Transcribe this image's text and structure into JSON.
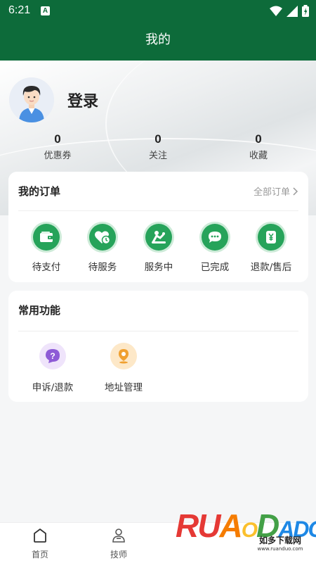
{
  "status_bar": {
    "time": "6:21",
    "notification_icon": "A"
  },
  "header": {
    "title": "我的"
  },
  "profile": {
    "login_text": "登录"
  },
  "stats": [
    {
      "value": "0",
      "label": "优惠券"
    },
    {
      "value": "0",
      "label": "关注"
    },
    {
      "value": "0",
      "label": "收藏"
    }
  ],
  "orders": {
    "title": "我的订单",
    "all_link": "全部订单",
    "items": [
      {
        "label": "待支付",
        "icon": "wallet-icon"
      },
      {
        "label": "待服务",
        "icon": "heart-clock-icon"
      },
      {
        "label": "服务中",
        "icon": "massage-icon"
      },
      {
        "label": "已完成",
        "icon": "chat-bubble-icon"
      },
      {
        "label": "退款/售后",
        "icon": "yen-refund-icon"
      }
    ]
  },
  "functions": {
    "title": "常用功能",
    "items": [
      {
        "label": "申诉/退款",
        "icon": "question-icon",
        "color": "#8e5bd6"
      },
      {
        "label": "地址管理",
        "icon": "location-pin-icon",
        "color": "#f0a030"
      }
    ]
  },
  "tabbar": {
    "items": [
      {
        "label": "首页",
        "icon": "home-icon"
      },
      {
        "label": "技师",
        "icon": "technician-icon"
      }
    ]
  },
  "watermark": {
    "letters": "RUANDADO",
    "cn": "如多下载网",
    "url": "www.ruanduo.com"
  },
  "colors": {
    "brand": "#0d6b3a",
    "accent": "#26a35a"
  }
}
